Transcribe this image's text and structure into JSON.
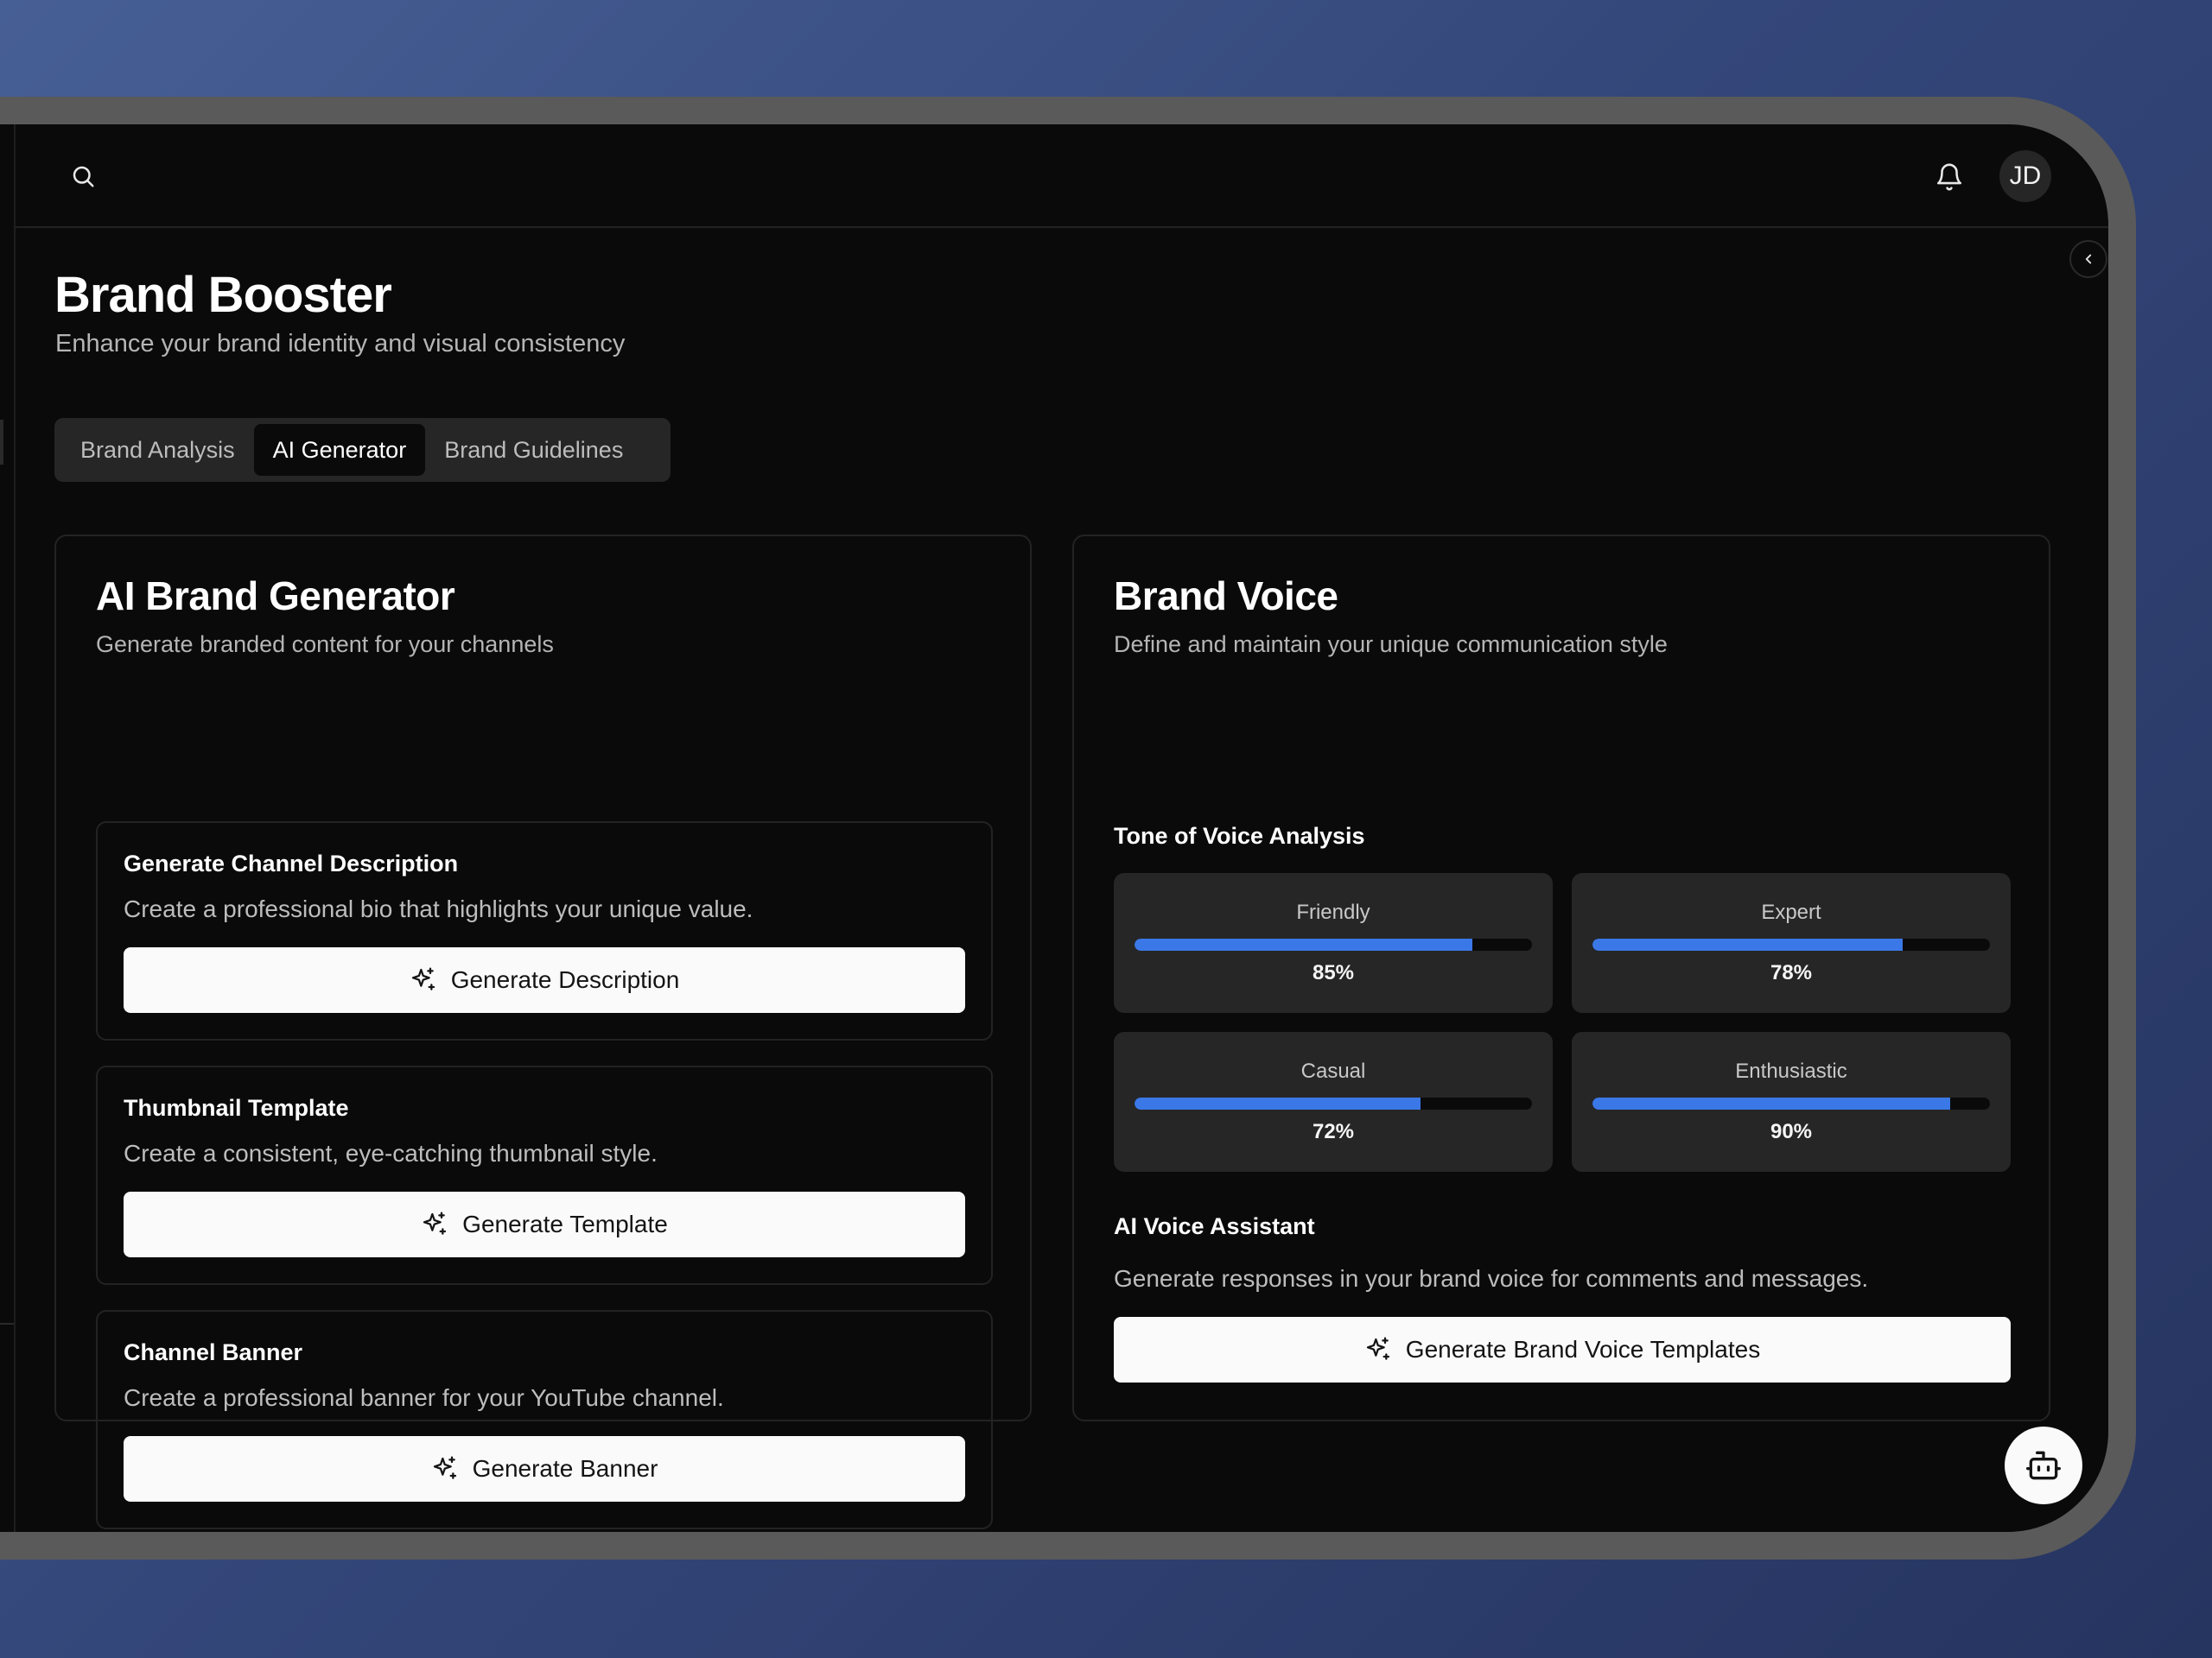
{
  "header": {
    "user_initials": "JD"
  },
  "page": {
    "title": "Brand Booster",
    "subtitle": "Enhance your brand identity and visual consistency"
  },
  "tabs": [
    {
      "label": "Brand Analysis",
      "active": false
    },
    {
      "label": "AI Generator",
      "active": true
    },
    {
      "label": "Brand Guidelines",
      "active": false
    }
  ],
  "generator": {
    "title": "AI Brand Generator",
    "subtitle": "Generate branded content for your channels",
    "items": [
      {
        "title": "Generate Channel Description",
        "description": "Create a professional bio that highlights your unique value.",
        "button_label": "Generate Description"
      },
      {
        "title": "Thumbnail Template",
        "description": "Create a consistent, eye-catching thumbnail style.",
        "button_label": "Generate Template"
      },
      {
        "title": "Channel Banner",
        "description": "Create a professional banner for your YouTube channel.",
        "button_label": "Generate Banner"
      }
    ]
  },
  "brand_voice": {
    "title": "Brand Voice",
    "subtitle": "Define and maintain your unique communication style",
    "tone_heading": "Tone of Voice Analysis",
    "tones": [
      {
        "name": "Friendly",
        "percent": 85,
        "label": "85%"
      },
      {
        "name": "Expert",
        "percent": 78,
        "label": "78%"
      },
      {
        "name": "Casual",
        "percent": 72,
        "label": "72%"
      },
      {
        "name": "Enthusiastic",
        "percent": 90,
        "label": "90%"
      }
    ],
    "assistant_heading": "AI Voice Assistant",
    "assistant_description": "Generate responses in your brand voice for comments and messages.",
    "assistant_button_label": "Generate Brand Voice Templates"
  },
  "icons": {
    "search": "search-icon",
    "notifications": "bell-icon",
    "collapse": "chevron-left-icon",
    "sparkle": "sparkles-icon",
    "assistant": "bot-icon"
  },
  "colors": {
    "accent": "#3b78e7",
    "background": "#0a0a0a",
    "tile": "#262626"
  }
}
